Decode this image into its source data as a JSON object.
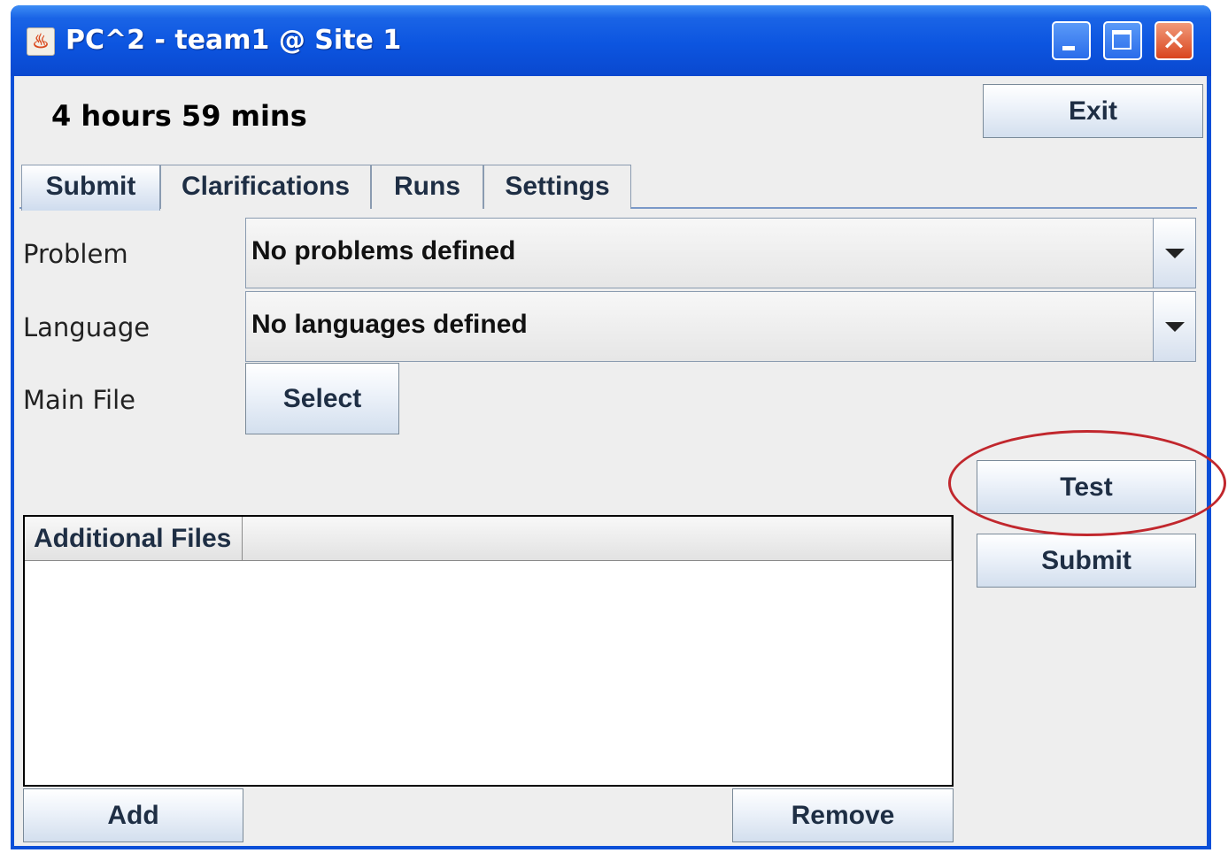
{
  "window": {
    "title": "PC^2 - team1 @ Site 1",
    "app_icon": "java-cup-icon",
    "controls": [
      "minimize-icon",
      "maximize-icon",
      "close-icon"
    ]
  },
  "header": {
    "time_remaining": "4 hours 59 mins",
    "exit_label": "Exit"
  },
  "tabs": [
    {
      "label": "Submit",
      "active": true
    },
    {
      "label": "Clarifications",
      "active": false
    },
    {
      "label": "Runs",
      "active": false
    },
    {
      "label": "Settings",
      "active": false
    }
  ],
  "submit_form": {
    "problem_label": "Problem",
    "problem_value": "No problems defined",
    "language_label": "Language",
    "language_value": "No languages defined",
    "main_file_label": "Main File",
    "select_label": "Select"
  },
  "additional_files": {
    "column_header": "Additional Files",
    "rows": [],
    "add_label": "Add",
    "remove_label": "Remove"
  },
  "actions": {
    "test_label": "Test",
    "submit_label": "Submit"
  },
  "annotation": {
    "color": "#c1272d",
    "target": "test-button"
  }
}
